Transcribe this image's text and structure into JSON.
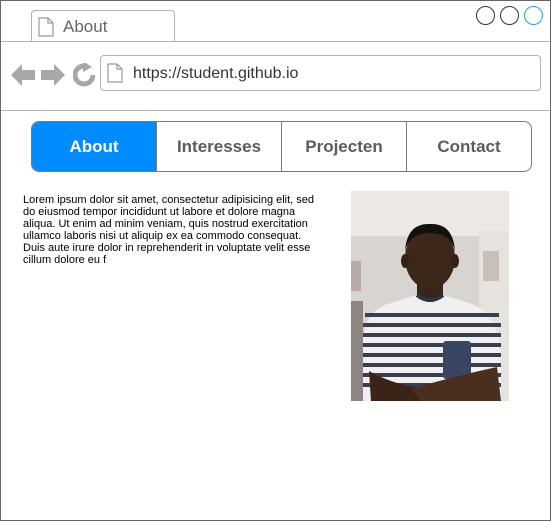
{
  "tab": {
    "title": "About",
    "icon": "page-icon"
  },
  "window_buttons": [
    "circle-button",
    "circle-button",
    "circle-button"
  ],
  "toolbar": {
    "back_icon": "back-arrow-icon",
    "forward_icon": "forward-arrow-icon",
    "reload_icon": "reload-icon",
    "url": "https://student.github.io"
  },
  "nav": {
    "items": [
      {
        "label": "About",
        "active": true
      },
      {
        "label": "Interesses",
        "active": false
      },
      {
        "label": "Projecten",
        "active": false
      },
      {
        "label": "Contact",
        "active": false
      }
    ]
  },
  "content": {
    "text": "Lorem ipsum dolor sit amet, consectetur adipisicing elit, sed do eiusmod tempor incididunt ut labore et dolore magna aliqua. Ut enim ad minim veniam, quis nostrud exercitation ullamco laboris nisi ut aliquip ex ea commodo consequat. Duis aute irure dolor in reprehenderit in voluptate velit esse cillum dolore eu f",
    "photo_alt": "portrait photo"
  },
  "colors": {
    "accent": "#008cff",
    "nav_text": "#5c5c5c",
    "border": "#b3b3b3"
  }
}
